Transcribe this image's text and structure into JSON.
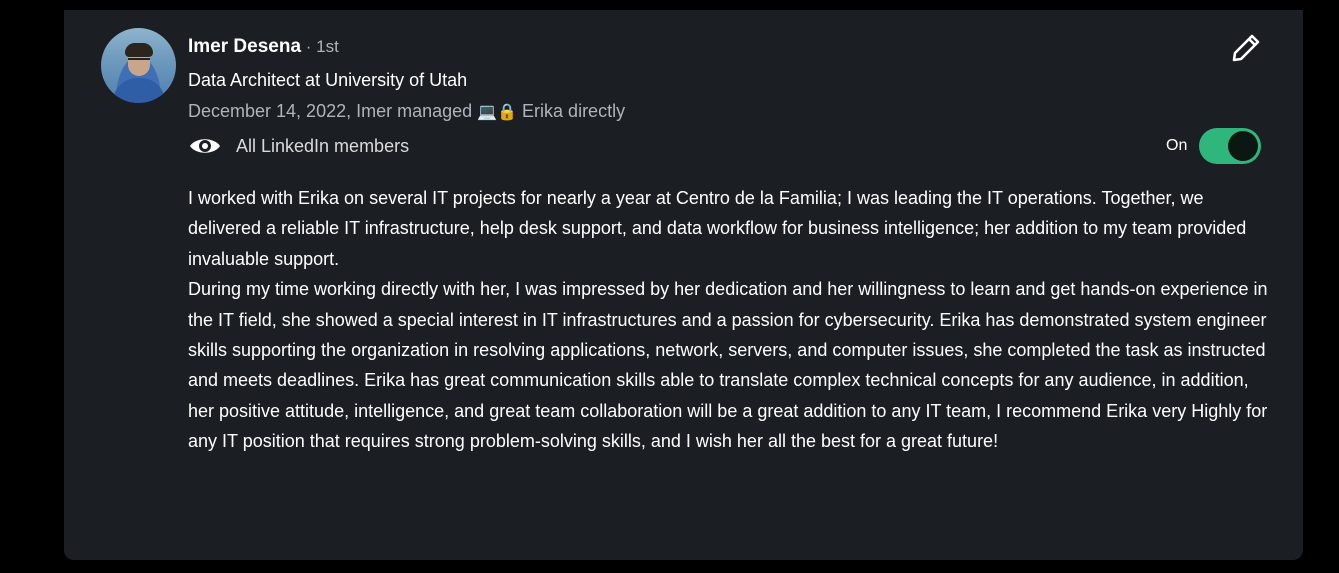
{
  "recommendation": {
    "author_name": "Imer Desena",
    "connection_degree": " · 1st",
    "headline": "Data Architect at University of Utah",
    "relationship": "December 14, 2022, Imer managed",
    "relationship_emojis": "💻🔒",
    "relationship_target": "Erika directly",
    "visibility_label": "All LinkedIn members",
    "visibility_icon": "eye-icon",
    "edit_icon": "pencil-icon",
    "toggle_label": "On",
    "toggle_state": "on",
    "toggle_color": "#2eb67d",
    "paragraphs": [
      "I worked with Erika on several IT projects for nearly a year at Centro de la Familia; I was leading the IT operations. Together, we delivered a reliable IT infrastructure, help desk support, and data workflow for business intelligence; her addition to my team provided invaluable support.",
      "During my time working directly with her, I was impressed by her dedication and her willingness to learn and get hands-on experience in the IT field, she showed a special interest in IT infrastructures and a passion for cybersecurity. Erika has demonstrated system engineer skills supporting the organization in resolving applications, network, servers, and computer issues, she completed the task as instructed and meets deadlines. Erika has great communication skills able to translate complex technical concepts for any audience, in addition, her positive attitude, intelligence, and great team collaboration will be a great addition to any IT team, I recommend Erika very Highly for any IT position that requires strong problem-solving skills, and I wish her all the best for a great future!"
    ]
  }
}
